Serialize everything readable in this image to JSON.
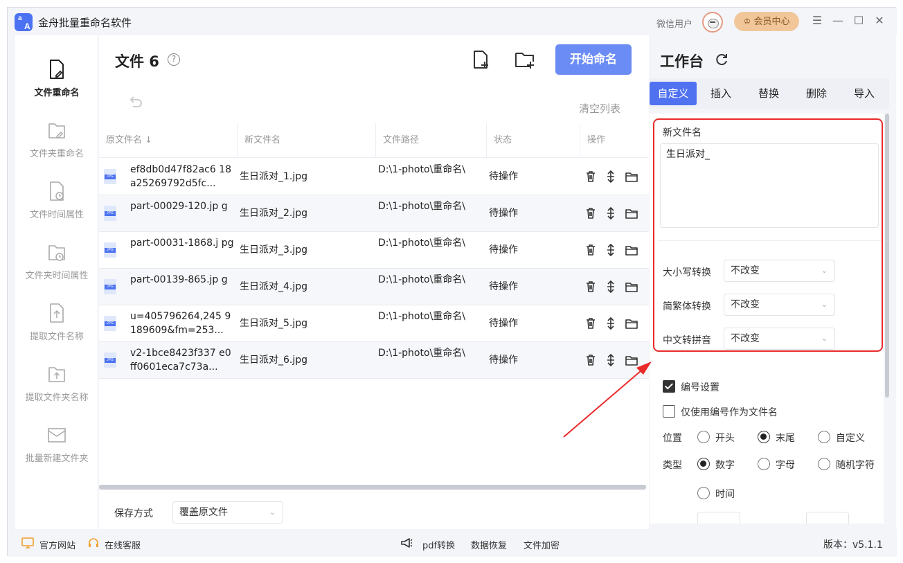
{
  "app": {
    "title": "金舟批量重命名软件",
    "logo_letters": [
      "a",
      "A"
    ],
    "user_name": "微信用户",
    "vip_label": "会员中心",
    "window_controls": [
      "menu-icon",
      "minimize-icon",
      "maximize-icon",
      "close-icon"
    ]
  },
  "sidebar": {
    "items": [
      {
        "label": "文件重命名",
        "icon": "file-edit-icon",
        "active": true
      },
      {
        "label": "文件夹重命名",
        "icon": "folder-edit-icon",
        "active": false
      },
      {
        "label": "文件时间属性",
        "icon": "file-clock-icon",
        "active": false
      },
      {
        "label": "文件夹时间属性",
        "icon": "folder-clock-icon",
        "active": false
      },
      {
        "label": "提取文件名称",
        "icon": "file-extract-icon",
        "active": false
      },
      {
        "label": "提取文件夹名称",
        "icon": "folder-extract-icon",
        "active": false
      },
      {
        "label": "批量新建文件夹",
        "icon": "folder-batch-icon",
        "active": false
      }
    ]
  },
  "main": {
    "file_count_label": "文件 6",
    "start_button": "开始命名",
    "clear_list": "清空列表",
    "columns": [
      "原文件名",
      "新文件名",
      "文件路径",
      "状态",
      "操作"
    ],
    "rows": [
      {
        "original": "ef8db0d47f82ac6 18a25269792d5fc...",
        "new_name": "生日派对_1.jpg",
        "path": "D:\\1-photo\\重命名\\",
        "status": "待操作"
      },
      {
        "original": "part-00029-120.jp g",
        "new_name": "生日派对_2.jpg",
        "path": "D:\\1-photo\\重命名\\",
        "status": "待操作"
      },
      {
        "original": "part-00031-1868.j pg",
        "new_name": "生日派对_3.jpg",
        "path": "D:\\1-photo\\重命名\\",
        "status": "待操作"
      },
      {
        "original": "part-00139-865.jp g",
        "new_name": "生日派对_4.jpg",
        "path": "D:\\1-photo\\重命名\\",
        "status": "待操作"
      },
      {
        "original": "u=405796264,245 9189609&fm=253...",
        "new_name": "生日派对_5.jpg",
        "path": "D:\\1-photo\\重命名\\",
        "status": "待操作"
      },
      {
        "original": "v2-1bce8423f337 e0ff0601eca7c73a...",
        "new_name": "生日派对_6.jpg",
        "path": "D:\\1-photo\\重命名\\",
        "status": "待操作"
      }
    ],
    "save_mode_label": "保存方式",
    "save_mode_value": "覆盖原文件"
  },
  "workbench": {
    "title": "工作台",
    "tabs": [
      "自定义",
      "插入",
      "替换",
      "删除",
      "导入"
    ],
    "active_tab": "自定义",
    "new_name_label": "新文件名",
    "new_name_value": "生日派对_",
    "case_label": "大小写转换",
    "case_value": "不改变",
    "trad_label": "简繁体转换",
    "trad_value": "不改变",
    "pinyin_label": "中文转拼音",
    "pinyin_value": "不改变",
    "numbering_label": "编号设置",
    "numbering_checked": true,
    "only_number_label": "仅使用编号作为文件名",
    "only_number_checked": false,
    "position_label": "位置",
    "position_options": [
      "开头",
      "末尾",
      "自定义"
    ],
    "position_selected": "末尾",
    "type_label": "类型",
    "type_options": [
      "数字",
      "字母",
      "随机字符",
      "时间"
    ],
    "type_selected": "数字"
  },
  "footer": {
    "website": "官方网站",
    "support": "在线客服",
    "links": [
      "pdf转换",
      "数据恢复",
      "文件加密"
    ],
    "version": "版本：v5.1.1"
  },
  "colors": {
    "accent": "#5072f0",
    "start_button": "#6c8cf5",
    "highlight_box": "#ea2a2a",
    "vip": "#f1c79a"
  }
}
